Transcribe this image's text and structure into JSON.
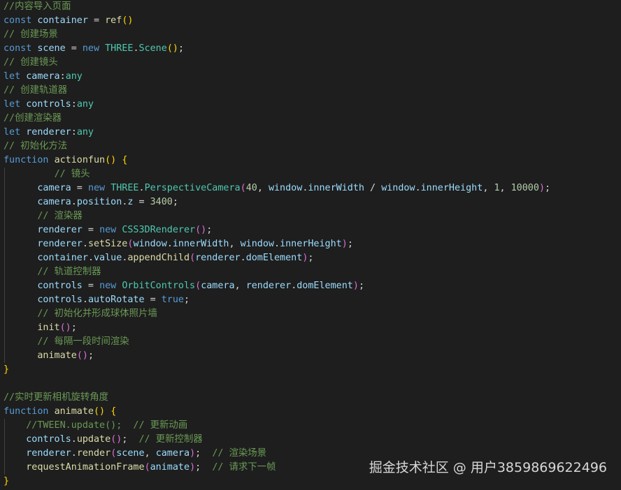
{
  "editor": {
    "theme": {
      "background": "#1e1e1e",
      "colors": {
        "kw": "#569cd6",
        "var": "#9cdcfe",
        "fn": "#dcdcaa",
        "type": "#4ec9b0",
        "num": "#b5cea8",
        "com": "#6a9955",
        "punc": "#d4d4d4",
        "br1": "#ffd700",
        "br2": "#da70d6",
        "br3": "#179fff"
      }
    },
    "lines": [
      [
        [
          "com",
          "//内容导入页面"
        ]
      ],
      [
        [
          "kw",
          "const"
        ],
        [
          "punc",
          " "
        ],
        [
          "var",
          "container"
        ],
        [
          "punc",
          " = "
        ],
        [
          "fn",
          "ref"
        ],
        [
          "br1",
          "()"
        ]
      ],
      [
        [
          "com",
          "// 创建场景"
        ]
      ],
      [
        [
          "kw",
          "const"
        ],
        [
          "punc",
          " "
        ],
        [
          "var",
          "scene"
        ],
        [
          "punc",
          " = "
        ],
        [
          "kw",
          "new"
        ],
        [
          "punc",
          " "
        ],
        [
          "type",
          "THREE"
        ],
        [
          "punc",
          "."
        ],
        [
          "type",
          "Scene"
        ],
        [
          "br1",
          "()"
        ],
        [
          "punc",
          ";"
        ]
      ],
      [
        [
          "com",
          "// 创建镜头"
        ]
      ],
      [
        [
          "kw",
          "let"
        ],
        [
          "punc",
          " "
        ],
        [
          "var",
          "camera"
        ],
        [
          "punc",
          ":"
        ],
        [
          "type",
          "any"
        ]
      ],
      [
        [
          "com",
          "// 创建轨道器"
        ]
      ],
      [
        [
          "kw",
          "let"
        ],
        [
          "punc",
          " "
        ],
        [
          "var",
          "controls"
        ],
        [
          "punc",
          ":"
        ],
        [
          "type",
          "any"
        ]
      ],
      [
        [
          "com",
          "//创建渲染器"
        ]
      ],
      [
        [
          "kw",
          "let"
        ],
        [
          "punc",
          " "
        ],
        [
          "var",
          "renderer"
        ],
        [
          "punc",
          ":"
        ],
        [
          "type",
          "any"
        ]
      ],
      [
        [
          "com",
          "// 初始化方法"
        ]
      ],
      [
        [
          "kw",
          "function"
        ],
        [
          "punc",
          " "
        ],
        [
          "fn",
          "actionfun"
        ],
        [
          "br1",
          "()"
        ],
        [
          "punc",
          " "
        ],
        [
          "br1",
          "{"
        ]
      ],
      [
        [
          "punc",
          "         "
        ],
        [
          "com",
          "// 镜头"
        ]
      ],
      [
        [
          "punc",
          "      "
        ],
        [
          "var",
          "camera"
        ],
        [
          "punc",
          " = "
        ],
        [
          "kw",
          "new"
        ],
        [
          "punc",
          " "
        ],
        [
          "type",
          "THREE"
        ],
        [
          "punc",
          "."
        ],
        [
          "type",
          "PerspectiveCamera"
        ],
        [
          "br2",
          "("
        ],
        [
          "num",
          "40"
        ],
        [
          "punc",
          ", "
        ],
        [
          "var",
          "window"
        ],
        [
          "punc",
          "."
        ],
        [
          "var",
          "innerWidth"
        ],
        [
          "punc",
          " / "
        ],
        [
          "var",
          "window"
        ],
        [
          "punc",
          "."
        ],
        [
          "var",
          "innerHeight"
        ],
        [
          "punc",
          ", "
        ],
        [
          "num",
          "1"
        ],
        [
          "punc",
          ", "
        ],
        [
          "num",
          "10000"
        ],
        [
          "br2",
          ")"
        ],
        [
          "punc",
          ";"
        ]
      ],
      [
        [
          "punc",
          "      "
        ],
        [
          "var",
          "camera"
        ],
        [
          "punc",
          "."
        ],
        [
          "var",
          "position"
        ],
        [
          "punc",
          "."
        ],
        [
          "var",
          "z"
        ],
        [
          "punc",
          " = "
        ],
        [
          "num",
          "3400"
        ],
        [
          "punc",
          ";"
        ]
      ],
      [
        [
          "punc",
          "      "
        ],
        [
          "com",
          "// 渲染器"
        ]
      ],
      [
        [
          "punc",
          "      "
        ],
        [
          "var",
          "renderer"
        ],
        [
          "punc",
          " = "
        ],
        [
          "kw",
          "new"
        ],
        [
          "punc",
          " "
        ],
        [
          "type",
          "CSS3DRenderer"
        ],
        [
          "br2",
          "()"
        ],
        [
          "punc",
          ";"
        ]
      ],
      [
        [
          "punc",
          "      "
        ],
        [
          "var",
          "renderer"
        ],
        [
          "punc",
          "."
        ],
        [
          "fn",
          "setSize"
        ],
        [
          "br2",
          "("
        ],
        [
          "var",
          "window"
        ],
        [
          "punc",
          "."
        ],
        [
          "var",
          "innerWidth"
        ],
        [
          "punc",
          ", "
        ],
        [
          "var",
          "window"
        ],
        [
          "punc",
          "."
        ],
        [
          "var",
          "innerHeight"
        ],
        [
          "br2",
          ")"
        ],
        [
          "punc",
          ";"
        ]
      ],
      [
        [
          "punc",
          "      "
        ],
        [
          "var",
          "container"
        ],
        [
          "punc",
          "."
        ],
        [
          "var",
          "value"
        ],
        [
          "punc",
          "."
        ],
        [
          "fn",
          "appendChild"
        ],
        [
          "br2",
          "("
        ],
        [
          "var",
          "renderer"
        ],
        [
          "punc",
          "."
        ],
        [
          "var",
          "domElement"
        ],
        [
          "br2",
          ")"
        ],
        [
          "punc",
          ";"
        ]
      ],
      [
        [
          "punc",
          "      "
        ],
        [
          "com",
          "// 轨道控制器"
        ]
      ],
      [
        [
          "punc",
          "      "
        ],
        [
          "var",
          "controls"
        ],
        [
          "punc",
          " = "
        ],
        [
          "kw",
          "new"
        ],
        [
          "punc",
          " "
        ],
        [
          "type",
          "OrbitControls"
        ],
        [
          "br2",
          "("
        ],
        [
          "var",
          "camera"
        ],
        [
          "punc",
          ", "
        ],
        [
          "var",
          "renderer"
        ],
        [
          "punc",
          "."
        ],
        [
          "var",
          "domElement"
        ],
        [
          "br2",
          ")"
        ],
        [
          "punc",
          ";"
        ]
      ],
      [
        [
          "punc",
          "      "
        ],
        [
          "var",
          "controls"
        ],
        [
          "punc",
          "."
        ],
        [
          "var",
          "autoRotate"
        ],
        [
          "punc",
          " = "
        ],
        [
          "kw",
          "true"
        ],
        [
          "punc",
          ";"
        ]
      ],
      [
        [
          "punc",
          "      "
        ],
        [
          "com",
          "// 初始化并形成球体照片墙"
        ]
      ],
      [
        [
          "punc",
          "      "
        ],
        [
          "fn",
          "init"
        ],
        [
          "br2",
          "()"
        ],
        [
          "punc",
          ";"
        ]
      ],
      [
        [
          "punc",
          "      "
        ],
        [
          "com",
          "// 每隔一段时间渲染"
        ]
      ],
      [
        [
          "punc",
          "      "
        ],
        [
          "fn",
          "animate"
        ],
        [
          "br2",
          "()"
        ],
        [
          "punc",
          ";"
        ]
      ],
      [
        [
          "br1",
          "}"
        ]
      ],
      [
        [
          "punc",
          ""
        ]
      ],
      [
        [
          "com",
          "//实时更新相机旋转角度"
        ]
      ],
      [
        [
          "kw",
          "function"
        ],
        [
          "punc",
          " "
        ],
        [
          "fn",
          "animate"
        ],
        [
          "br1",
          "()"
        ],
        [
          "punc",
          " "
        ],
        [
          "br1",
          "{"
        ]
      ],
      [
        [
          "punc",
          "    "
        ],
        [
          "com",
          "//TWEEN.update();  // 更新动画"
        ]
      ],
      [
        [
          "punc",
          "    "
        ],
        [
          "var",
          "controls"
        ],
        [
          "punc",
          "."
        ],
        [
          "fn",
          "update"
        ],
        [
          "br2",
          "()"
        ],
        [
          "punc",
          ";  "
        ],
        [
          "com",
          "// 更新控制器"
        ]
      ],
      [
        [
          "punc",
          "    "
        ],
        [
          "var",
          "renderer"
        ],
        [
          "punc",
          "."
        ],
        [
          "fn",
          "render"
        ],
        [
          "br2",
          "("
        ],
        [
          "var",
          "scene"
        ],
        [
          "punc",
          ", "
        ],
        [
          "var",
          "camera"
        ],
        [
          "br2",
          ")"
        ],
        [
          "punc",
          ";  "
        ],
        [
          "com",
          "// 渲染场景"
        ]
      ],
      [
        [
          "punc",
          "    "
        ],
        [
          "fn",
          "requestAnimationFrame"
        ],
        [
          "br2",
          "("
        ],
        [
          "var",
          "animate"
        ],
        [
          "br2",
          ")"
        ],
        [
          "punc",
          ";  "
        ],
        [
          "com",
          "// 请求下一帧"
        ]
      ],
      [
        [
          "br1",
          "}"
        ]
      ]
    ]
  },
  "watermark": {
    "text": "掘金技术社区 @ 用户3859869622496"
  }
}
